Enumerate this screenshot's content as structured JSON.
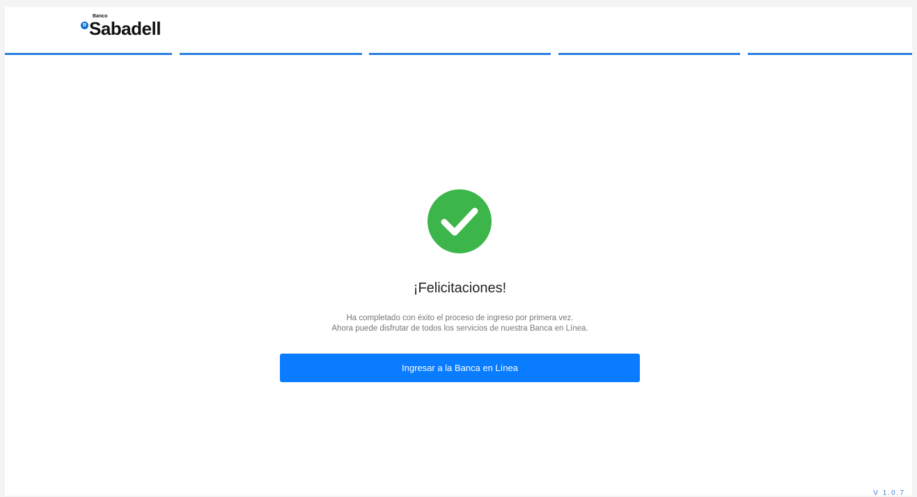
{
  "brand": {
    "badge_letter": "B",
    "small_label": "Banco",
    "name": "Sabadell",
    "color": "#0a6dcc"
  },
  "progress": {
    "total_steps": 5,
    "completed_steps": 5,
    "color": "#2a7de1"
  },
  "success": {
    "icon": "check-circle-icon",
    "icon_color": "#3cb54a",
    "title": "¡Felicitaciones!",
    "message_line_1": "Ha completado con éxito el proceso de ingreso por primera vez.",
    "message_line_2": "Ahora puede disfrutar de todos los servicios de nuestra Banca en Línea."
  },
  "actions": {
    "primary_label": "Ingresar a la Banca en Línea",
    "primary_color": "#0a7cff"
  },
  "footer": {
    "version": "V 1.0.7"
  }
}
